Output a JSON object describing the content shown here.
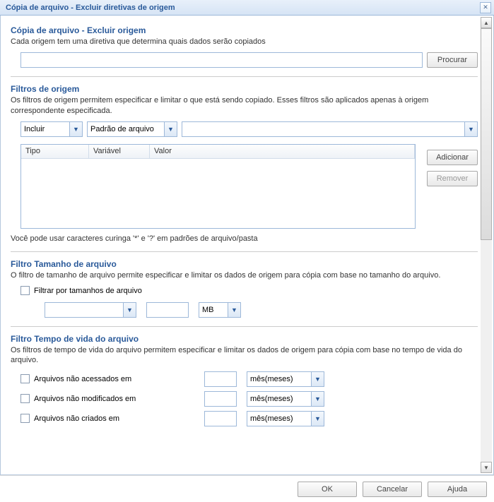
{
  "window": {
    "title": "Cópia de arquivo - Excluir diretivas de origem"
  },
  "section1": {
    "title": "Cópia de arquivo - Excluir origem",
    "desc": "Cada origem tem uma diretiva que determina quais dados serão copiados",
    "browse": "Procurar"
  },
  "section2": {
    "title": "Filtros de origem",
    "desc": "Os filtros de origem permitem especificar e limitar o que está sendo copiado. Esses filtros são aplicados apenas à origem correspondente especificada.",
    "combo1": "Incluir",
    "combo2": "Padrão de arquivo",
    "combo3": "",
    "cols": {
      "tipo": "Tipo",
      "variavel": "Variável",
      "valor": "Valor"
    },
    "add": "Adicionar",
    "remove": "Remover",
    "hint": "Você pode usar caracteres curinga '*' e '?' em padrões de arquivo/pasta"
  },
  "section3": {
    "title": "Filtro Tamanho de arquivo",
    "desc": "O filtro de tamanho de arquivo permite especificar e limitar os dados de origem para cópia com base no tamanho do arquivo.",
    "chk": "Filtrar por tamanhos de arquivo",
    "unit": "MB"
  },
  "section4": {
    "title": "Filtro Tempo de vida do arquivo",
    "desc": "Os filtros de tempo de vida do arquivo permitem especificar e limitar os dados de origem para cópia com base no tempo de vida do arquivo.",
    "row1": "Arquivos não acessados em",
    "row2": "Arquivos não modificados em",
    "row3": "Arquivos não criados em",
    "unit": "mês(meses)"
  },
  "buttons": {
    "ok": "OK",
    "cancel": "Cancelar",
    "help": "Ajuda"
  }
}
